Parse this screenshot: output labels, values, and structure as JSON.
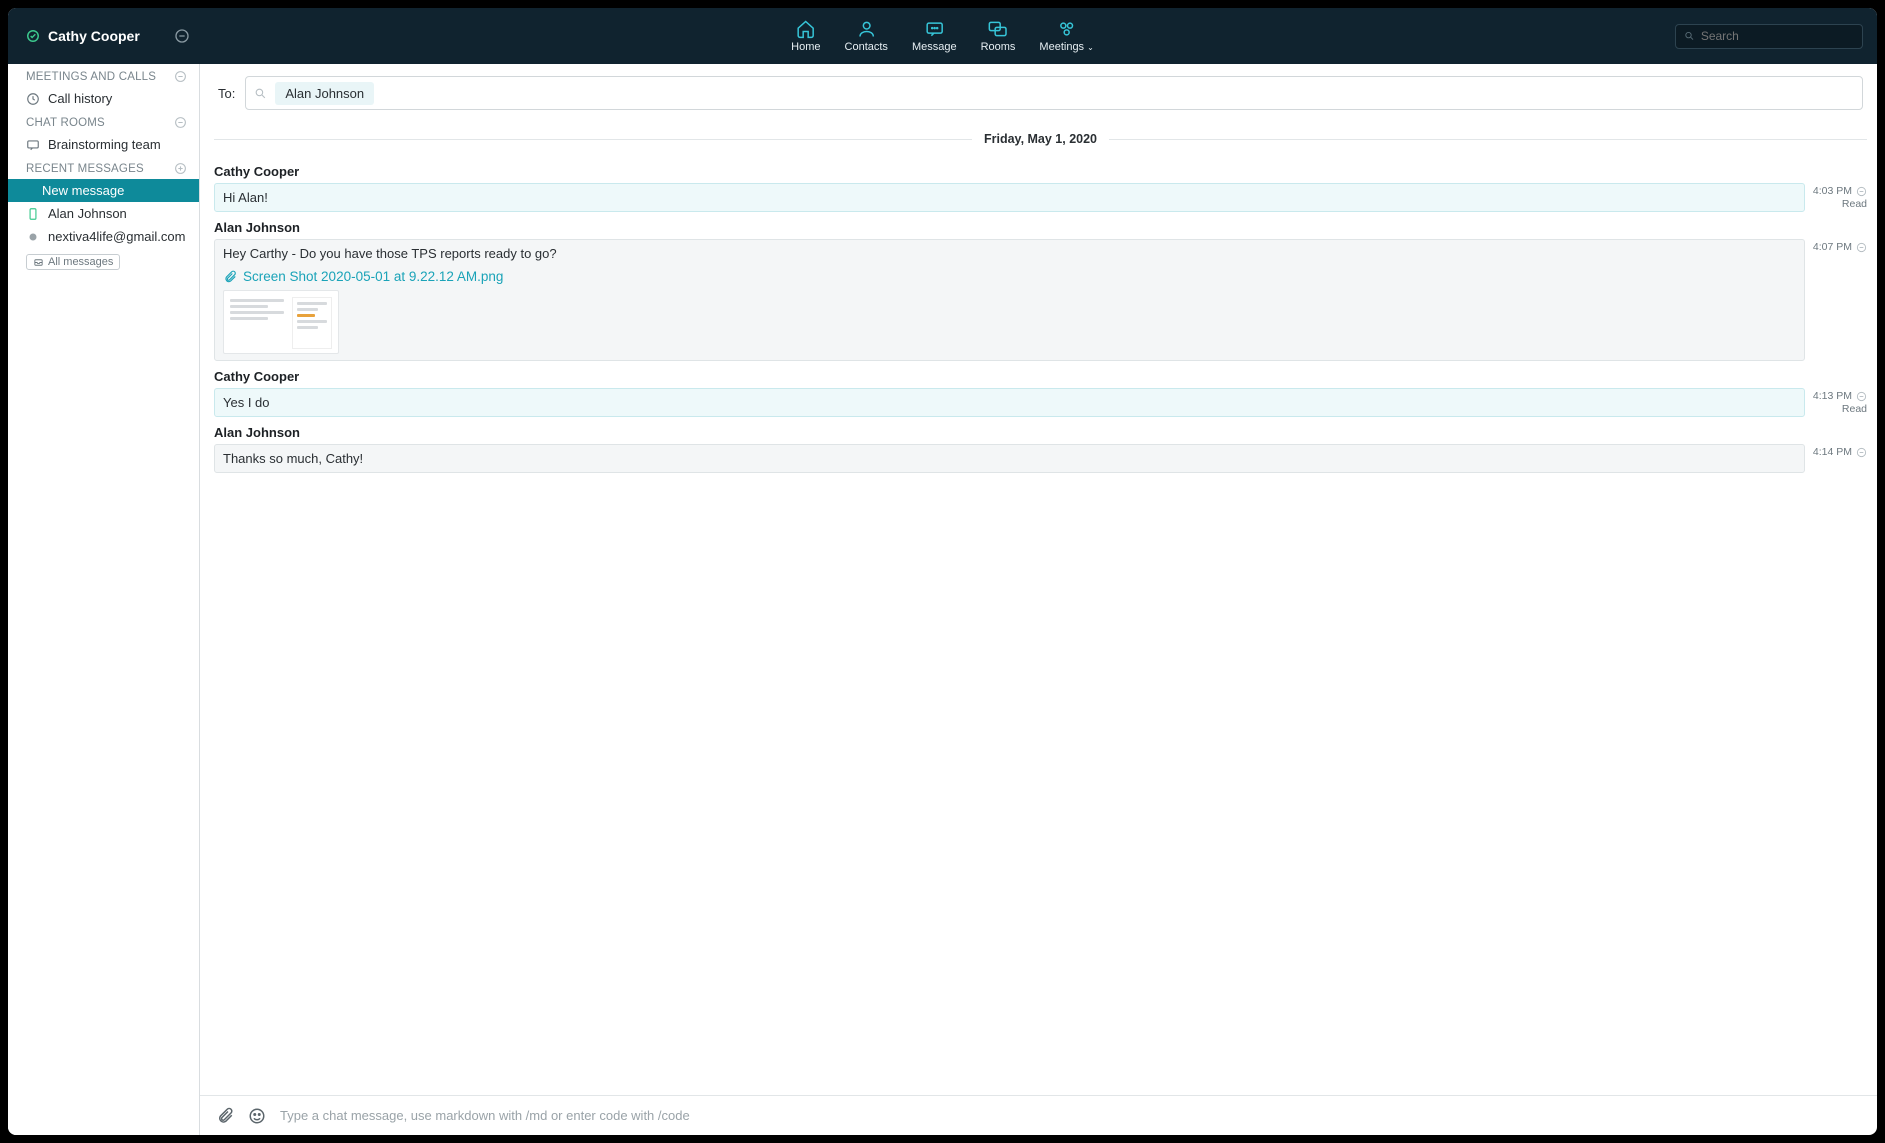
{
  "header": {
    "user_name": "Cathy Cooper",
    "search_placeholder": "Search",
    "nav": {
      "home": "Home",
      "contacts": "Contacts",
      "message": "Message",
      "rooms": "Rooms",
      "meetings": "Meetings"
    }
  },
  "sidebar": {
    "sections": {
      "meetings": "MEETINGS AND CALLS",
      "chatrooms": "CHAT ROOMS",
      "recent": "RECENT MESSAGES"
    },
    "call_history": "Call history",
    "brainstorm": "Brainstorming team",
    "new_message": "New message",
    "alan": "Alan Johnson",
    "nextiva": "nextiva4life@gmail.com",
    "all_messages": "All messages"
  },
  "compose": {
    "to_label": "To:",
    "recipient": "Alan Johnson",
    "input_placeholder": "Type a chat message, use markdown with /md or enter code with /code"
  },
  "conversation": {
    "date": "Friday, May 1, 2020",
    "m1": {
      "sender": "Cathy Cooper",
      "text": "Hi Alan!",
      "time": "4:03 PM",
      "status": "Read"
    },
    "m2": {
      "sender": "Alan Johnson",
      "text": "Hey Carthy - Do you have those TPS reports ready to go?",
      "attachment": "Screen Shot 2020-05-01 at 9.22.12 AM.png",
      "time": "4:07 PM"
    },
    "m3": {
      "sender": "Cathy Cooper",
      "text": "Yes I do",
      "time": "4:13 PM",
      "status": "Read"
    },
    "m4": {
      "sender": "Alan Johnson",
      "text": "Thanks so much, Cathy!",
      "time": "4:14 PM"
    }
  }
}
